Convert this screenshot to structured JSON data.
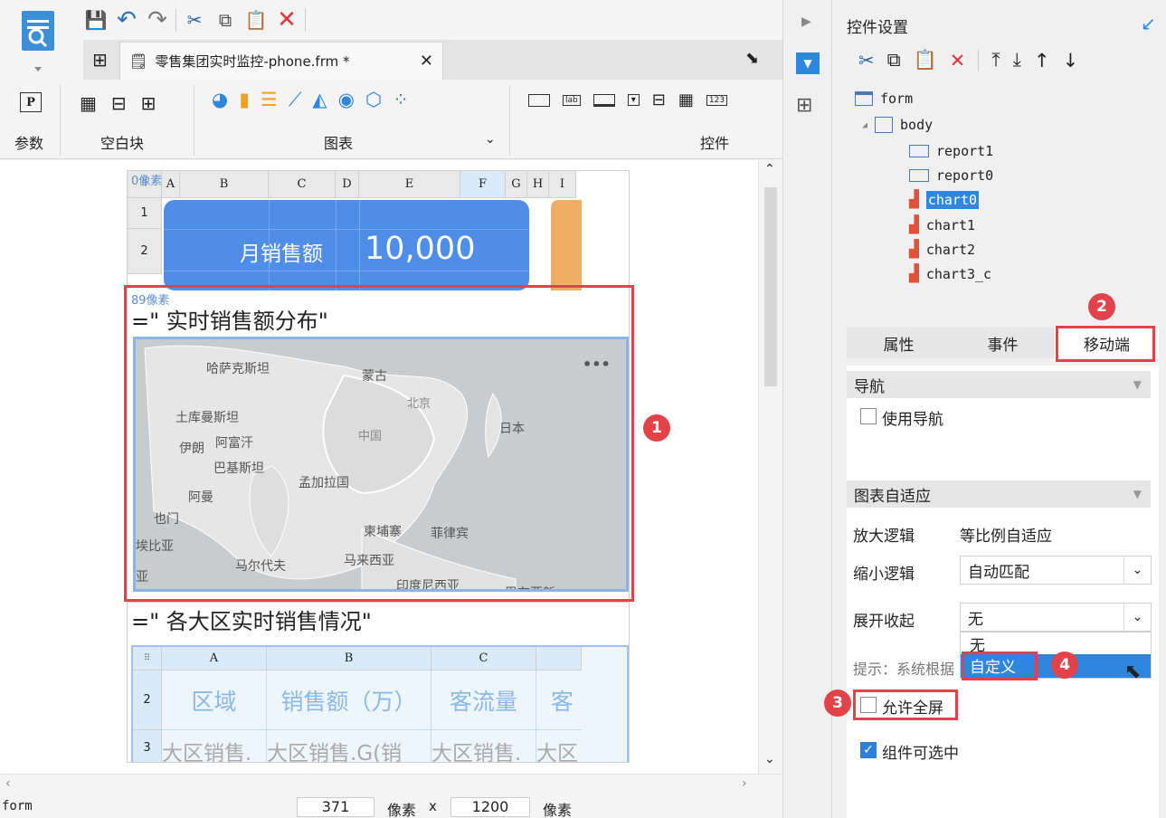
{
  "toolbar": {
    "file_tab_label": "零售集团实时监控-phone.frm *",
    "ribbon_groups": [
      "参数",
      "空白块",
      "图表",
      "控件"
    ]
  },
  "canvas": {
    "col_headers_top": [
      "A",
      "B",
      "C",
      "D",
      "E",
      "F",
      "G",
      "H",
      "I"
    ],
    "row_headers_top": [
      "1",
      "2"
    ],
    "top_pixel_label": "0像素",
    "kpi_label": "月销售额",
    "kpi_value": "10,000",
    "chart_pixel_label": "89像素",
    "chart_title": "=\"  实时销售额分布\"",
    "table_title": "=\"  各大区实时销售情况\"",
    "table_col_headers": [
      "A",
      "B",
      "C"
    ],
    "table_row_headers": [
      "2",
      "3"
    ],
    "table_header_cells": [
      "区域",
      "销售额（万）",
      "客流量",
      "客"
    ],
    "table_data_cells": [
      "大区销售.",
      "大区销售.G(销",
      "大区销售.",
      "大区"
    ],
    "map_labels": [
      "哈萨克斯坦",
      "蒙古",
      "北京",
      "土库曼斯坦",
      "中国",
      "日本",
      "伊朗",
      "阿富汗",
      "巴基斯坦",
      "孟加拉国",
      "阿曼",
      "也门",
      "柬埔寨",
      "菲律宾",
      "埃比亚",
      "马尔代夫",
      "马来西亚",
      "亚",
      "印度尼西亚",
      "巴布亚新"
    ]
  },
  "status": {
    "selection": "form",
    "width": "371",
    "unit1": "像素",
    "times": "x",
    "height": "1200",
    "unit2": "像素"
  },
  "panel": {
    "title": "控件设置",
    "tree": [
      "form",
      "body",
      "report1",
      "report0",
      "chart0",
      "chart1",
      "chart2",
      "chart3_c"
    ],
    "tabs": [
      "属性",
      "事件",
      "移动端"
    ],
    "nav_section": "导航",
    "use_nav": "使用导航",
    "adapt_section": "图表自适应",
    "zoom_in_label": "放大逻辑",
    "zoom_in_value": "等比例自适应",
    "zoom_out_label": "缩小逻辑",
    "zoom_out_value": "自动匹配",
    "expand_label": "展开收起",
    "expand_value": "无",
    "dropdown_options": [
      "无",
      "自定义"
    ],
    "hint_text": "提示：系统根据",
    "allow_fullscreen": "允许全屏",
    "selectable": "组件可选中"
  },
  "badges": [
    "1",
    "2",
    "3",
    "4"
  ]
}
